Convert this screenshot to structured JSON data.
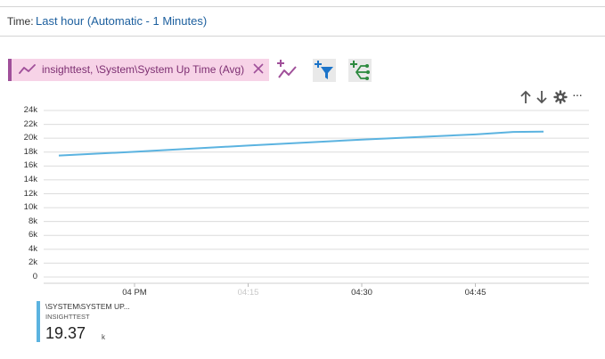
{
  "time_bar": {
    "label": "Time:",
    "value": "Last hour (Automatic - 1 Minutes)"
  },
  "metric": {
    "label": "insighttest, \\System\\System Up Time (Avg)",
    "color": "#a0509a",
    "background": "#f7d3e7"
  },
  "toolbar": {
    "icons": [
      "add-metric-icon",
      "add-filter-icon",
      "split-icon"
    ]
  },
  "chart_actions": {
    "icons": [
      "move-up-icon",
      "move-down-icon",
      "settings-icon",
      "more-icon"
    ],
    "more_label": "···"
  },
  "chart_data": {
    "type": "line",
    "y_tick_labels": [
      "24k",
      "22k",
      "20k",
      "18k",
      "16k",
      "14k",
      "12k",
      "10k",
      "8k",
      "6k",
      "4k",
      "2k",
      "0"
    ],
    "ylim": [
      0,
      24000
    ],
    "x_tick_labels": [
      {
        "label": "04 PM",
        "faded": false
      },
      {
        "label": "04:15",
        "faded": true
      },
      {
        "label": "04:30",
        "faded": false
      },
      {
        "label": "04:45",
        "faded": false
      }
    ],
    "xlim_minutes": [
      -12,
      60
    ],
    "x_ticks_minutes": [
      0,
      15,
      30,
      45
    ],
    "grid": true,
    "series": [
      {
        "color": "#5bb3e0",
        "x_minutes": [
          -10,
          0,
          15,
          30,
          45,
          50,
          54
        ],
        "values": [
          17500,
          18050,
          18950,
          19800,
          20550,
          20900,
          20950
        ]
      }
    ]
  },
  "legend": {
    "series_name": "\\SYSTEM\\SYSTEM UP...",
    "sub_label": "INSIGHTTEST",
    "value": "19.37",
    "unit": "k",
    "color": "#5bb3e0"
  }
}
